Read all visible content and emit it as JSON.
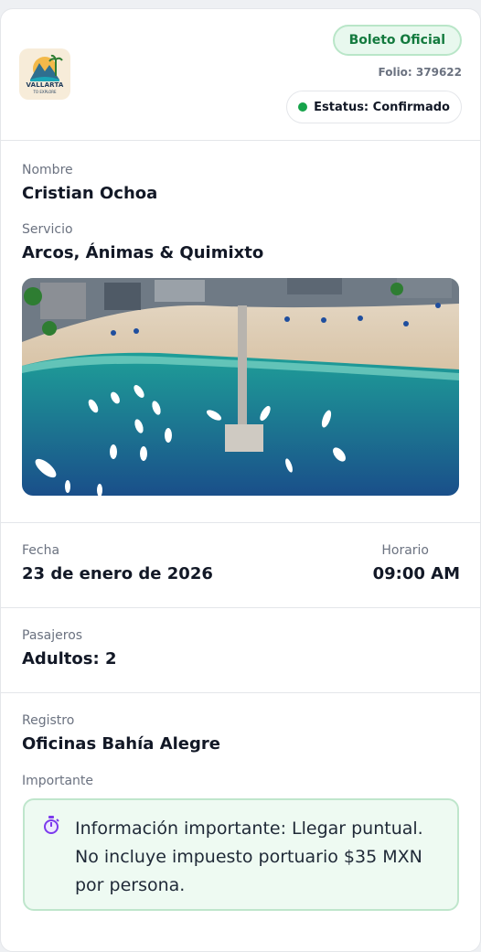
{
  "brand": {
    "logo_text": "VALLARTA",
    "logo_subtext": "TO EXPLORE"
  },
  "header": {
    "badge": "Boleto Oficial",
    "folio": "Folio: 379622",
    "status": "Estatus: Confirmado",
    "status_color": "#16a34a"
  },
  "details": {
    "name_label": "Nombre",
    "name_value": "Cristian Ochoa",
    "service_label": "Servicio",
    "service_value": "Arcos, Ánimas & Quimixto",
    "photo_icon": "aerial-beach-photo"
  },
  "schedule": {
    "date_label": "Fecha",
    "date_value": "23 de enero de 2026",
    "time_label": "Horario",
    "time_value": "09:00 AM"
  },
  "passengers": {
    "label": "Pasajeros",
    "value": "Adultos: 2"
  },
  "registration": {
    "label": "Registro",
    "value": "Oficinas Bahía Alegre",
    "important_label": "Importante",
    "important_icon": "stopwatch-icon",
    "important_text": "Información importante: Llegar puntual. No incluye impuesto portuario $35 MXN por persona."
  },
  "colors": {
    "accent_green": "#137a3e",
    "note_background": "#eefaf2"
  }
}
